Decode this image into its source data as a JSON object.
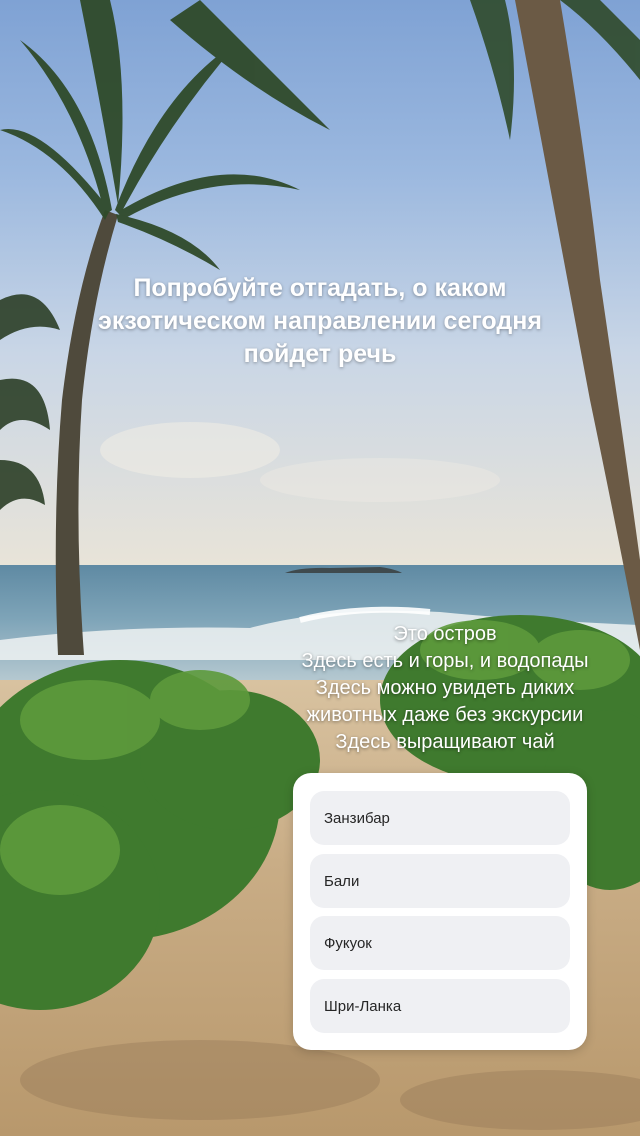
{
  "story": {
    "title": "Попробуйте отгадать, о каком экзотическом направлении сегодня пойдет речь",
    "hints": [
      "Это остров",
      "Здесь есть и горы, и водопады",
      "Здесь можно увидеть диких",
      "животных даже без экскурсии",
      "Здесь выращивают чай"
    ]
  },
  "quiz": {
    "options": [
      "Занзибар",
      "Бали",
      "Фукуок",
      "Шри-Ланка"
    ]
  }
}
